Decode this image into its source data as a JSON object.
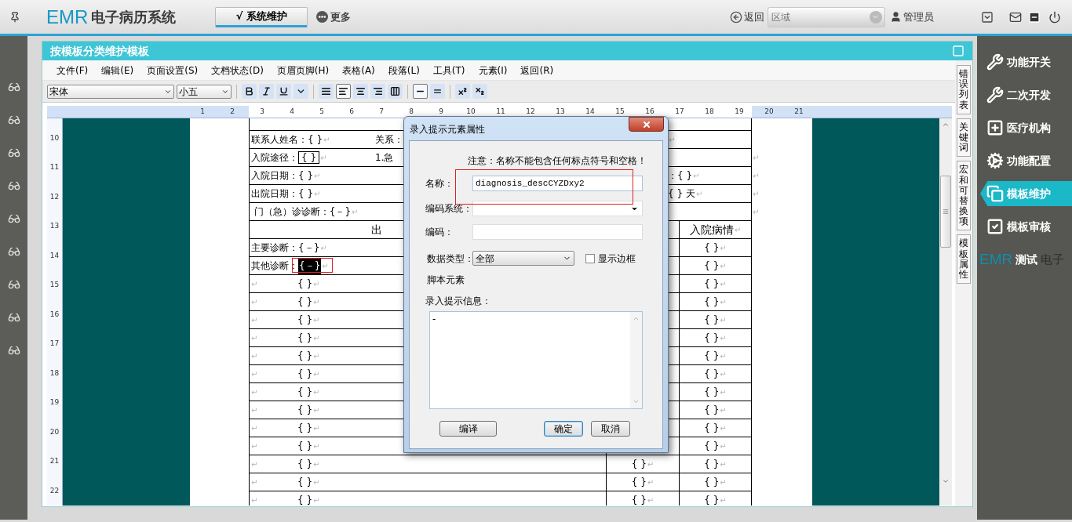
{
  "topbar": {
    "logo_mark": "EMR",
    "logo_text": "电子病历系统",
    "tabs": [
      {
        "label": "√ 系统维护",
        "selected": true
      },
      {
        "label": "更多",
        "selected": false
      }
    ],
    "back": "返回",
    "region": {
      "placeholder": "区域"
    },
    "user": "管理员"
  },
  "panel": {
    "title": "按模板分类维护模板"
  },
  "menu": [
    "文件(F)",
    "编辑(E)",
    "页面设置(S)",
    "文档状态(D)",
    "页眉页脚(H)",
    "表格(A)",
    "段落(L)",
    "工具(T)",
    "元素(I)",
    "返回(R)"
  ],
  "toolbar": {
    "font": "宋体",
    "size": "小五",
    "buttons": [
      {
        "kind": "bold",
        "selected": false
      },
      {
        "kind": "italic",
        "selected": false
      },
      {
        "kind": "underline",
        "selected": false
      },
      {
        "kind": "more",
        "selected": false
      },
      {
        "kind": "justify",
        "selected": false
      },
      {
        "kind": "left",
        "selected": true
      },
      {
        "kind": "center",
        "selected": false
      },
      {
        "kind": "right",
        "selected": false
      },
      {
        "kind": "distribute",
        "selected": false
      },
      {
        "kind": "single",
        "selected": true
      },
      {
        "kind": "double",
        "selected": false
      },
      {
        "kind": "superscript",
        "selected": false
      },
      {
        "kind": "subscript",
        "selected": false
      }
    ]
  },
  "ruler": [
    "1",
    "2",
    "3",
    "4",
    "5",
    "6",
    "7",
    "8",
    "9",
    "10",
    "11",
    "12",
    "13",
    "14",
    "15",
    "16",
    "17",
    "18",
    "19",
    "20",
    "21"
  ],
  "vertical_ruler": [
    "10",
    "11",
    "12",
    "13",
    "14",
    "15",
    "16",
    "17",
    "18",
    "19",
    "20",
    "21",
    "22"
  ],
  "document": {
    "rows": [
      {
        "kind": "line",
        "left": {
          "text": "联系人姓名：{ }",
          "end": "↵"
        },
        "middle": {
          "text": "关系："
        },
        "right": {
          "end": "↵"
        }
      },
      {
        "kind": "line",
        "left": {
          "text": "入院途径：",
          "box": "{ }",
          "end": "↵"
        },
        "middle": {
          "text": "1.急"
        },
        "outside": "↵"
      },
      {
        "kind": "line",
        "left": {
          "text": "入院日期：{ }",
          "end": "↵"
        },
        "right": {
          "text": "：{ }",
          "end": "↵"
        },
        "outside": "↵"
      },
      {
        "kind": "line",
        "left": {
          "text": "出院日期：{ }",
          "end": "↵"
        },
        "right": {
          "text": "{ } 天",
          "end": "↵"
        },
        "outside": "↵"
      },
      {
        "kind": "line",
        "left": {
          "text": " 门（急）诊诊断：{－}",
          "end": "↵"
        },
        "outside": "↵"
      },
      {
        "kind": "header",
        "main": {
          "text": "出"
        },
        "last": {
          "text": "入院病情",
          "end": "↵"
        }
      },
      {
        "kind": "grid",
        "main": {
          "text": "主要诊断：{－}",
          "end": "↵"
        },
        "last": {
          "text": "{ }",
          "end": "↵"
        }
      },
      {
        "kind": "grid",
        "main": {
          "text": "其他诊断：",
          "field": {
            "text": "{－}",
            "selected": true,
            "annotated": true
          },
          "end": "↵"
        },
        "last": {
          "text": "{ }",
          "end": "↵"
        }
      },
      {
        "kind": "grid",
        "main": {
          "lead": "↵",
          "text": "{ }",
          "end": "↵"
        },
        "last": {
          "text": "{ }",
          "end": "↵"
        }
      },
      {
        "kind": "grid",
        "main": {
          "lead": "↵",
          "text": "{ }",
          "end": "↵"
        },
        "last": {
          "text": "{ }",
          "end": "↵"
        }
      },
      {
        "kind": "grid",
        "main": {
          "lead": "↵",
          "text": "{ }",
          "end": "↵"
        },
        "last": {
          "text": "{ }",
          "end": "↵"
        }
      },
      {
        "kind": "grid",
        "main": {
          "lead": "↵",
          "text": "{ }",
          "end": "↵"
        },
        "last": {
          "text": "{ }",
          "end": "↵"
        }
      },
      {
        "kind": "grid",
        "main": {
          "lead": "↵",
          "text": "{ }",
          "end": "↵"
        },
        "last": {
          "text": "{ }",
          "end": "↵"
        }
      },
      {
        "kind": "grid",
        "main": {
          "lead": "↵",
          "text": "{ }",
          "end": "↵"
        },
        "last": {
          "text": "{ }",
          "end": "↵"
        }
      },
      {
        "kind": "grid",
        "main": {
          "lead": "↵",
          "text": "{ }",
          "end": "↵"
        },
        "last": {
          "text": "{ }",
          "end": "↵"
        }
      },
      {
        "kind": "grid",
        "main": {
          "lead": "↵",
          "text": "{ }",
          "end": "↵"
        },
        "last": {
          "text": "{ }",
          "end": "↵"
        }
      },
      {
        "kind": "grid",
        "main": {
          "lead": "↵",
          "text": "{ }",
          "end": "↵"
        },
        "last": {
          "text": "{ }",
          "end": "↵"
        }
      },
      {
        "kind": "grid",
        "main": {
          "lead": "↵",
          "text": "{ }",
          "end": "↵"
        },
        "last": {
          "text": "{ }",
          "end": "↵"
        }
      },
      {
        "kind": "grid",
        "main": {
          "lead": "↵",
          "text": "{ }",
          "end": "↵"
        },
        "middle": {
          "text": "{ }",
          "end": "↵"
        },
        "last": {
          "text": "{ }",
          "end": "↵"
        }
      },
      {
        "kind": "grid",
        "main": {
          "lead": "↵",
          "text": "{ }",
          "end": "↵"
        },
        "middle": {
          "text": "{ }",
          "end": "↵"
        },
        "last": {
          "text": "{ }",
          "end": "↵"
        }
      },
      {
        "kind": "grid",
        "main": {
          "lead": "↵",
          "text": "{ }",
          "end": "↵"
        },
        "middle": {
          "text": "{ }",
          "end": "↵"
        },
        "last": {
          "text": "{ }",
          "end": "↵"
        }
      }
    ]
  },
  "side_tabs": [
    "错误列表",
    "关键词",
    "宏和可替换项",
    "模板属性"
  ],
  "sidebar": {
    "items": [
      {
        "kind": "switch",
        "label": "功能开关",
        "selected": false
      },
      {
        "kind": "develop",
        "label": "二次开发",
        "selected": false
      },
      {
        "kind": "hospital",
        "label": "医疗机构",
        "selected": false
      },
      {
        "kind": "config",
        "label": "功能配置",
        "selected": false
      },
      {
        "kind": "template",
        "label": "模板维护",
        "selected": true
      },
      {
        "kind": "review",
        "label": "模板审核",
        "selected": false
      },
      {
        "kind": "plain",
        "label": "测试",
        "selected": false,
        "backdrop": [
          "EMR",
          "电子"
        ]
      }
    ]
  },
  "dialog": {
    "title": "录入提示元素属性",
    "notice": "注意：名称不能包含任何标点符号和空格！",
    "name": {
      "label": "名称：",
      "value": "diagnosis_descCYZDxy2",
      "annotated": true
    },
    "code_system": {
      "label": "编码系统："
    },
    "code": {
      "label": "编码："
    },
    "data_type": {
      "label": "数据类型：",
      "value": "全部"
    },
    "show_border": {
      "label": "显示边框",
      "checked": false
    },
    "script_label": "脚本元素",
    "prompt": {
      "label": "录入提示信息：",
      "value": "-"
    },
    "buttons": [
      {
        "label": "编译",
        "default": false
      },
      {
        "label": "确定",
        "default": true
      },
      {
        "label": "取消",
        "default": false
      }
    ]
  }
}
